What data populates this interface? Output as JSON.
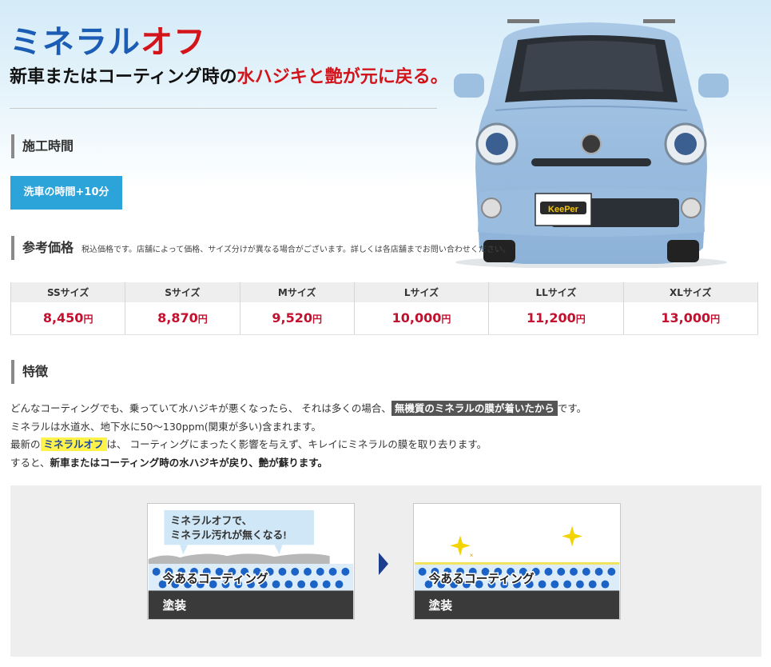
{
  "title": {
    "part1": "ミネラル",
    "part2": "オフ"
  },
  "subtitle": {
    "part1": "新車またはコーティング時の",
    "part2": "水ハジキと艶が元に戻る。"
  },
  "work_time": {
    "heading": "施工時間",
    "value": "洗車の時間+10分"
  },
  "price": {
    "heading": "参考価格",
    "note": "税込価格です。店舗によって価格、サイズ分けが異なる場合がございます。詳しくは各店舗までお問い合わせください。",
    "yen": "円",
    "sizes": [
      {
        "label": "SSサイズ",
        "value": "8,450"
      },
      {
        "label": "Sサイズ",
        "value": "8,870"
      },
      {
        "label": "Mサイズ",
        "value": "9,520"
      },
      {
        "label": "Lサイズ",
        "value": "10,000"
      },
      {
        "label": "LLサイズ",
        "value": "11,200"
      },
      {
        "label": "XLサイズ",
        "value": "13,000"
      }
    ]
  },
  "features": {
    "heading": "特徴",
    "line1_a": "どんなコーティングでも、乗っていて水ハジキが悪くなったら、 それは多くの場合、",
    "line1_hl": "無機質のミネラルの膜が着いたから",
    "line1_b": "です。",
    "line2": "ミネラルは水道水、地下水に50～130ppm(関東が多い)含まれます。",
    "line3_a": "最新の",
    "line3_hl": "ミネラルオフ",
    "line3_b": "は、 コーティングにまったく影響を与えず、キレイにミネラルの膜を取り去ります。",
    "line4_a": "すると、",
    "line4_b": "新車またはコーティング時の水ハジキが戻り、艶が蘇ります。"
  },
  "diagram": {
    "bubble_line1": "ミネラルオフで、",
    "bubble_line2": "ミネラル汚れが無くなる!",
    "coating_label": "今あるコーティング",
    "paint_label": "塗装"
  },
  "car": {
    "plate_text": "KeePer"
  },
  "colors": {
    "blue_title": "#1b5db4",
    "red": "#d4141b",
    "badge": "#2ca3d9",
    "price_red": "#c3102e",
    "arrow": "#1d3d8f"
  }
}
